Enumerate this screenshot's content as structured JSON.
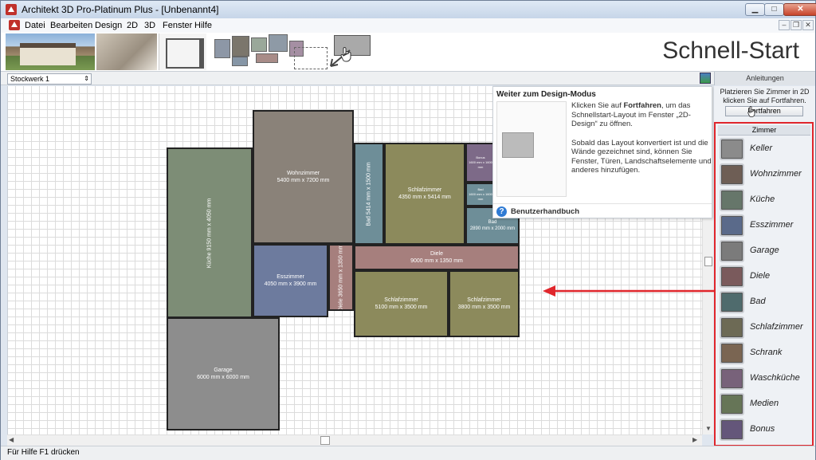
{
  "window": {
    "title": "Architekt 3D Pro-Platinum Plus - [Unbenannt4]",
    "controls": {
      "minimize": "▁",
      "maximize": "□",
      "close": "✕"
    }
  },
  "menu": {
    "items": [
      "Datei",
      "Bearbeiten",
      "Design",
      "2D",
      "3D",
      "Fenster",
      "Hilfe"
    ],
    "mdi_controls": {
      "minimize": "–",
      "restore": "❐",
      "close": "✕"
    }
  },
  "banner": {
    "title": "Schnell-Start"
  },
  "toolbar": {
    "floor_select": "Stockwerk 1",
    "anleitungen_header": "Anleitungen"
  },
  "floorplan": {
    "rooms": [
      {
        "name": "Wohnzimmer",
        "dims": "5400 mm x 7200 mm",
        "color": "#8a8279"
      },
      {
        "name": "Küche",
        "dims": "9150 mm x 4050 mm",
        "color": "#7d8d76"
      },
      {
        "name": "Bad",
        "dims": "5414 mm x 1500 mm",
        "color": "#6e8e98"
      },
      {
        "name": "Schlafzimmer",
        "dims": "4350 mm x 5414 mm",
        "color": "#8c8a5c"
      },
      {
        "name": "Bonus",
        "dims": "1600 mm x 1600 mm",
        "color": "#7d6a88"
      },
      {
        "name": "Bad",
        "dims": "1600 mm x 1600 mm",
        "color": "#6e8e98"
      },
      {
        "name": "Bad",
        "dims": "2890 mm x 2000 mm",
        "color": "#6e8e98"
      },
      {
        "name": "Diele",
        "dims": "9000 mm x 1350 mm",
        "color": "#a67f7d"
      },
      {
        "name": "Esszimmer",
        "dims": "4050 mm x 3900 mm",
        "color": "#6d7b9e"
      },
      {
        "name": "Diele",
        "dims": "3650 mm x 1350 mm",
        "color": "#a67f7d"
      },
      {
        "name": "Schlafzimmer",
        "dims": "5100 mm x 3500 mm",
        "color": "#8c8a5c"
      },
      {
        "name": "Schlafzimmer",
        "dims": "3800 mm x 3500 mm",
        "color": "#8c8a5c"
      },
      {
        "name": "Garage",
        "dims": "6000 mm x 6000 mm",
        "color": "#8d8d8d"
      }
    ]
  },
  "popup": {
    "title": "Weiter zum Design-Modus",
    "body_1_before": "Klicken Sie auf ",
    "body_1_bold": "Fortfahren",
    "body_1_after": ", um das Schnellstart-Layout im Fenster „2D-Design“ zu öffnen.",
    "body_2": "Sobald das Layout konvertiert ist und die Wände gezeichnet sind, können Sie Fenster, Türen, Landschaftselemente und anderes hinzufügen.",
    "help_link": "Benutzerhandbuch"
  },
  "sidebar": {
    "instruction": "Platzieren Sie Zimmer in 2D klicken Sie auf Fortfahren.",
    "continue_button": "Fortfahren",
    "zimmer_header": "Zimmer",
    "rooms": [
      {
        "label": "Keller",
        "color": "#8b8b8b"
      },
      {
        "label": "Wohnzimmer",
        "color": "#6e5e55"
      },
      {
        "label": "Küche",
        "color": "#66766a"
      },
      {
        "label": "Esszimmer",
        "color": "#5a6a8a"
      },
      {
        "label": "Garage",
        "color": "#7b7b7b"
      },
      {
        "label": "Diele",
        "color": "#7a5a5c"
      },
      {
        "label": "Bad",
        "color": "#4f6b6d"
      },
      {
        "label": "Schlafzimmer",
        "color": "#6d6a55"
      },
      {
        "label": "Schrank",
        "color": "#7a6552"
      },
      {
        "label": "Waschküche",
        "color": "#78627a"
      },
      {
        "label": "Medien",
        "color": "#667557"
      },
      {
        "label": "Bonus",
        "color": "#64567a"
      }
    ]
  },
  "status": {
    "text": "Für Hilfe F1 drücken"
  },
  "colors": {
    "highlight": "#e0262c"
  }
}
